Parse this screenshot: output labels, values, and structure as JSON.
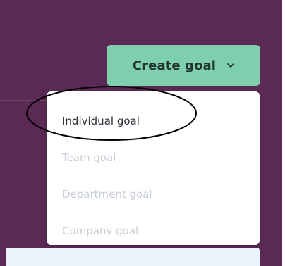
{
  "create_goal_button": {
    "label": "Create goal",
    "icon": "chevron-down-icon"
  },
  "dropdown": {
    "items": [
      {
        "label": "Individual goal",
        "state": "enabled"
      },
      {
        "label": "Team goal",
        "state": "disabled"
      },
      {
        "label": "Department goal",
        "state": "disabled"
      },
      {
        "label": "Company goal",
        "state": "disabled"
      }
    ]
  },
  "colors": {
    "background": "#5a2a54",
    "button": "#7ecfad",
    "menu": "#ffffff",
    "disabled_text": "#c8ced8",
    "annotation": "#000000",
    "bottom_strip": "#e8f3fb"
  }
}
